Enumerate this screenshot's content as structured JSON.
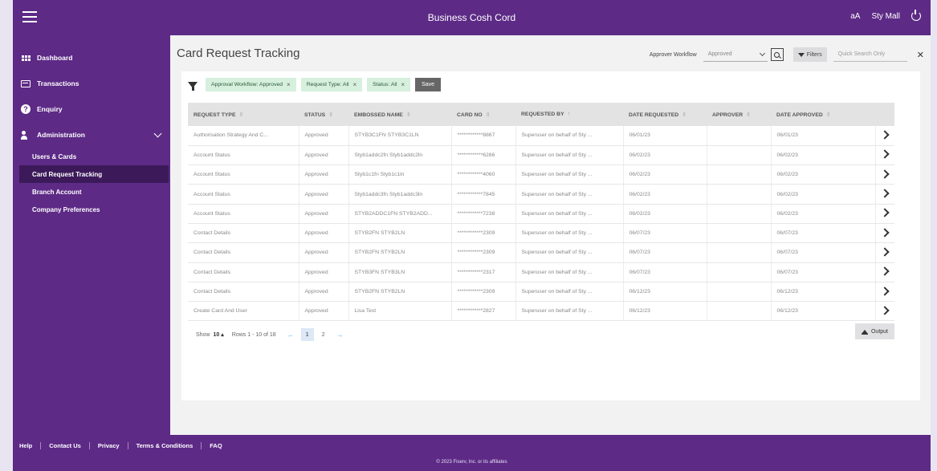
{
  "topbar": {
    "title": "Business Cosh Cord",
    "font_size_label": "aA",
    "user_name": "Sty Mall"
  },
  "sidebar": {
    "items": [
      {
        "label": "Dashboard",
        "icon": "grid-icon"
      },
      {
        "label": "Transactions",
        "icon": "card-icon"
      },
      {
        "label": "Enquiry",
        "icon": "question-icon"
      },
      {
        "label": "Administration",
        "icon": "users-icon"
      }
    ],
    "subitems": [
      {
        "label": "Users & Cards"
      },
      {
        "label": "Card Request Tracking"
      },
      {
        "label": "Branch Account"
      },
      {
        "label": "Company Preferences"
      }
    ]
  },
  "main": {
    "title": "Card Request Tracking",
    "approver_workflow_label": "Approver Workflow",
    "approver_workflow_value": "Approved",
    "filters_label": "Filters",
    "quick_search_placeholder": "Quick Search Only",
    "chips": [
      "Approval Workflow: Approved",
      "Request Type: All",
      "Status: All"
    ],
    "save_label": "Save"
  },
  "table": {
    "headers": [
      "REQUEST TYPE",
      "STATUS",
      "EMBOSSED NAME",
      "CARD NO",
      "REQUESTED BY",
      "DATE REQUESTED",
      "APPROVER",
      "DATE APPROVED"
    ],
    "rows": [
      [
        "Authorisation Strategy And C...",
        "Approved",
        "STYB3C1FN STYB3C1LN",
        "************8867",
        "Superuser on behalf of Sty ...",
        "06/01/23",
        "",
        "06/01/23"
      ],
      [
        "Account Status",
        "Approved",
        "Styb1addc2fn Styb1addc2ln",
        "************6286",
        "Superuser on behalf of Sty ...",
        "06/02/23",
        "",
        "06/02/23"
      ],
      [
        "Account Status",
        "Approved",
        "Styb1c1fn Styb1c1ln",
        "************4060",
        "Superuser on behalf of Sty ...",
        "06/02/23",
        "",
        "06/02/23"
      ],
      [
        "Account Status",
        "Approved",
        "Styb1addc3fn Styb1addc3ln",
        "************7845",
        "Superuser on behalf of Sty ...",
        "06/02/23",
        "",
        "06/02/23"
      ],
      [
        "Account Status",
        "Approved",
        "STYB2ADDC1FN STYB2ADD...",
        "************7238",
        "Superuser on behalf of Sty ...",
        "06/02/23",
        "",
        "06/02/23"
      ],
      [
        "Contact Details",
        "Approved",
        "STYB2FN STYB2LN",
        "************2309",
        "Superuser on behalf of Sty ...",
        "06/07/23",
        "",
        "06/07/23"
      ],
      [
        "Contact Details",
        "Approved",
        "STYB2FN STYB2LN",
        "************2309",
        "Superuser on behalf of Sty ...",
        "06/07/23",
        "",
        "06/07/23"
      ],
      [
        "Contact Details",
        "Approved",
        "STYB3FN STYB3LN",
        "************2317",
        "Superuser on behalf of Sty ...",
        "06/07/23",
        "",
        "06/07/23"
      ],
      [
        "Contact Details",
        "Approved",
        "STYB2FN STYB2LN",
        "************2309",
        "Superuser on behalf of Sty ...",
        "06/12/23",
        "",
        "06/12/23"
      ],
      [
        "Create Card And User",
        "Approved",
        "Lisa Test",
        "************2827",
        "Superuser on behalf of Sty ...",
        "06/12/23",
        "",
        "06/12/23"
      ]
    ]
  },
  "pager": {
    "show_label": "Show",
    "show_value": "10",
    "rows_info": "Rows 1 - 10 of 18",
    "pages": [
      "1",
      "2"
    ],
    "output_label": "Output"
  },
  "footer": {
    "links": [
      "Help",
      "Contact Us",
      "Privacy",
      "Terms & Conditions",
      "FAQ"
    ],
    "copyright": "© 2023 Fiserv, Inc. or its affiliates"
  }
}
